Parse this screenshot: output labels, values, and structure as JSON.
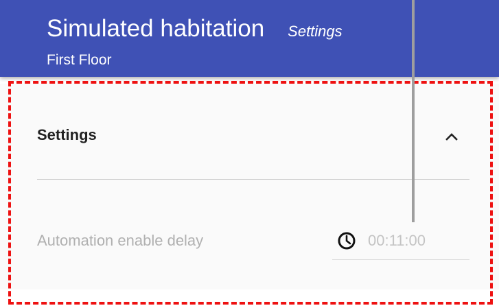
{
  "header": {
    "title": "Simulated habitation",
    "subtitle": "Settings",
    "floor": "First Floor",
    "background_color": "#3f51b5"
  },
  "settings_section": {
    "title": "Settings",
    "expanded": true,
    "toggle_icon": "chevron-up-icon"
  },
  "automation_delay": {
    "label": "Automation enable delay",
    "value": "00:11:00",
    "icon": "clock-icon"
  },
  "highlight_color": "#ee1111"
}
